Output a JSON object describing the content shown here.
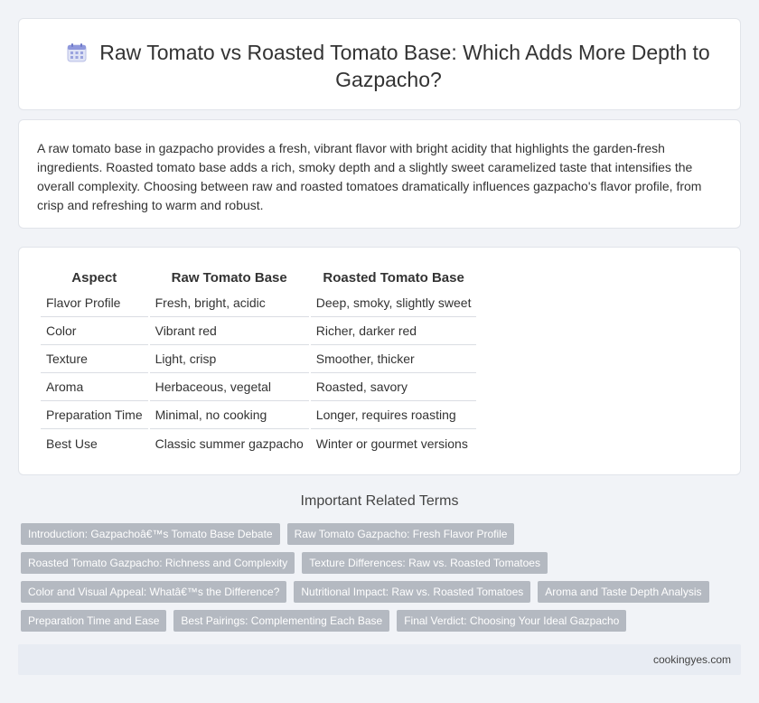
{
  "header": {
    "icon": "calendar-icon",
    "title": "Raw Tomato vs Roasted Tomato Base: Which Adds More Depth to Gazpacho?"
  },
  "summary": "A raw tomato base in gazpacho provides a fresh, vibrant flavor with bright acidity that highlights the garden-fresh ingredients. Roasted tomato base adds a rich, smoky depth and a slightly sweet caramelized taste that intensifies the overall complexity. Choosing between raw and roasted tomatoes dramatically influences gazpacho's flavor profile, from crisp and refreshing to warm and robust.",
  "table": {
    "headers": [
      "Aspect",
      "Raw Tomato Base",
      "Roasted Tomato Base"
    ],
    "rows": [
      [
        "Flavor Profile",
        "Fresh, bright, acidic",
        "Deep, smoky, slightly sweet"
      ],
      [
        "Color",
        "Vibrant red",
        "Richer, darker red"
      ],
      [
        "Texture",
        "Light, crisp",
        "Smoother, thicker"
      ],
      [
        "Aroma",
        "Herbaceous, vegetal",
        "Roasted, savory"
      ],
      [
        "Preparation Time",
        "Minimal, no cooking",
        "Longer, requires roasting"
      ],
      [
        "Best Use",
        "Classic summer gazpacho",
        "Winter or gourmet versions"
      ]
    ]
  },
  "related": {
    "title": "Important Related Terms",
    "tags": [
      [
        "Introduction: Gazpachoâ€™s Tomato Base Debate",
        "Raw Tomato Gazpacho: Fresh Flavor Profile"
      ],
      [
        "Roasted Tomato Gazpacho: Richness and Complexity",
        "Texture Differences: Raw vs. Roasted Tomatoes"
      ],
      [
        "Color and Visual Appeal: Whatâ€™s the Difference?",
        "Nutritional Impact: Raw vs. Roasted Tomatoes",
        "Aroma and Taste Depth Analysis"
      ],
      [
        "Preparation Time and Ease",
        "Best Pairings: Complementing Each Base",
        "Final Verdict: Choosing Your Ideal Gazpacho"
      ]
    ]
  },
  "footer": {
    "site": "cookingyes.com"
  },
  "colors": {
    "background": "#f1f3f7",
    "tag_bg": "#b4b9c1",
    "footer_bg": "#e8ecf3"
  }
}
